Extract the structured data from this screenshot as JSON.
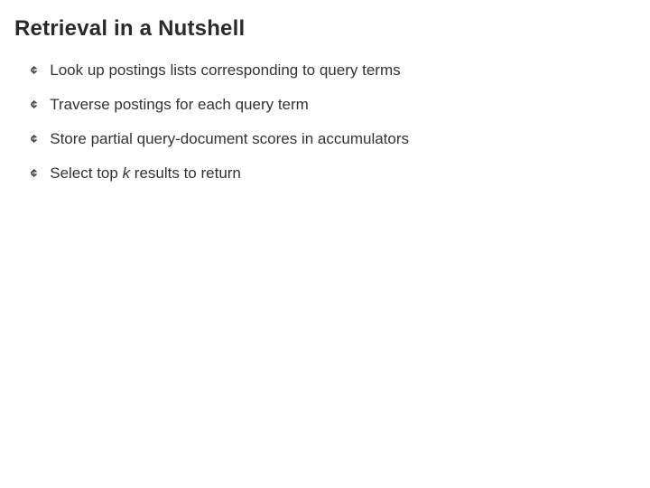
{
  "slide": {
    "title": "Retrieval in a Nutshell",
    "bullets": [
      {
        "text": "Look up postings lists corresponding to query terms"
      },
      {
        "text": "Traverse postings for each query term"
      },
      {
        "text": "Store partial query-document scores in accumulators"
      },
      {
        "text_prefix": "Select top ",
        "italic": "k",
        "text_suffix": " results to return"
      }
    ],
    "marker": "¢"
  }
}
